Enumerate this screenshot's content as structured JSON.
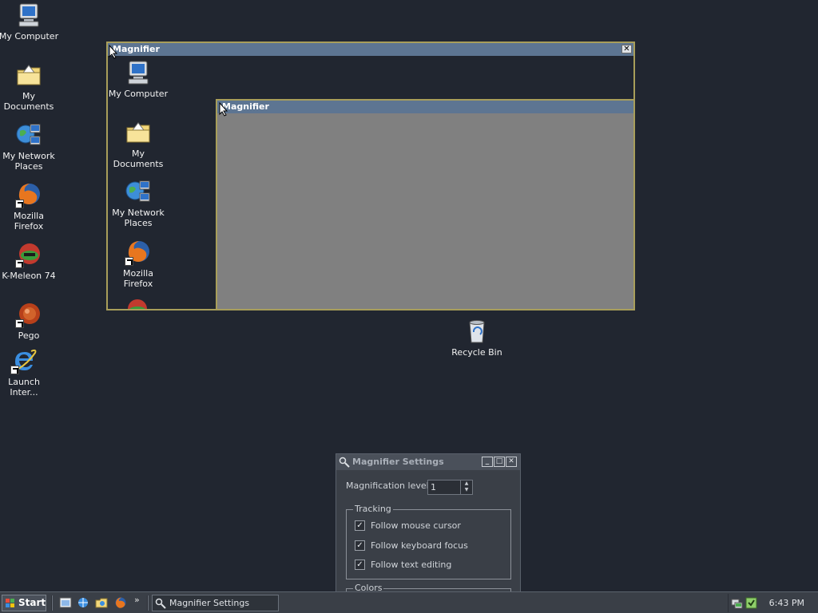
{
  "desktop": {
    "icons": [
      {
        "label": "My Computer",
        "icon": "computer-icon"
      },
      {
        "label": "My Documents",
        "icon": "documents-folder-icon"
      },
      {
        "label": "My Network Places",
        "icon": "network-places-icon"
      },
      {
        "label": "Mozilla Firefox",
        "icon": "firefox-icon"
      },
      {
        "label": "K-Meleon 74",
        "icon": "kmeleon-icon"
      },
      {
        "label": "Pego",
        "icon": "pego-icon"
      },
      {
        "label": "Launch Inter...",
        "icon": "internet-explorer-icon"
      },
      {
        "label": "Recycle Bin",
        "icon": "recycle-bin-icon"
      }
    ]
  },
  "magnifier": {
    "title": "Magnifier",
    "inner_title": "Magnifier",
    "close_glyph": "✕",
    "zoomed_icons": [
      {
        "label": "My Computer"
      },
      {
        "label": "My Documents"
      },
      {
        "label": "My Network Places"
      },
      {
        "label": "Mozilla Firefox"
      }
    ]
  },
  "settings": {
    "title": "Magnifier Settings",
    "magnification_label": "Magnification level:",
    "magnification_value": "1",
    "tracking_label": "Tracking",
    "options": [
      {
        "label": "Follow mouse cursor",
        "checked": true
      },
      {
        "label": "Follow keyboard focus",
        "checked": true
      },
      {
        "label": "Follow text editing",
        "checked": true
      }
    ],
    "colors_label": "Colors"
  },
  "taskbar": {
    "start_label": "Start",
    "chevron": "»",
    "task_label": "Magnifier Settings",
    "clock": "6:43 PM"
  },
  "colors": {
    "desktop": "#212630",
    "title_bar": "#5d7592",
    "magnifier_border": "#a89e5a",
    "magnifier_fill": "#808080"
  }
}
